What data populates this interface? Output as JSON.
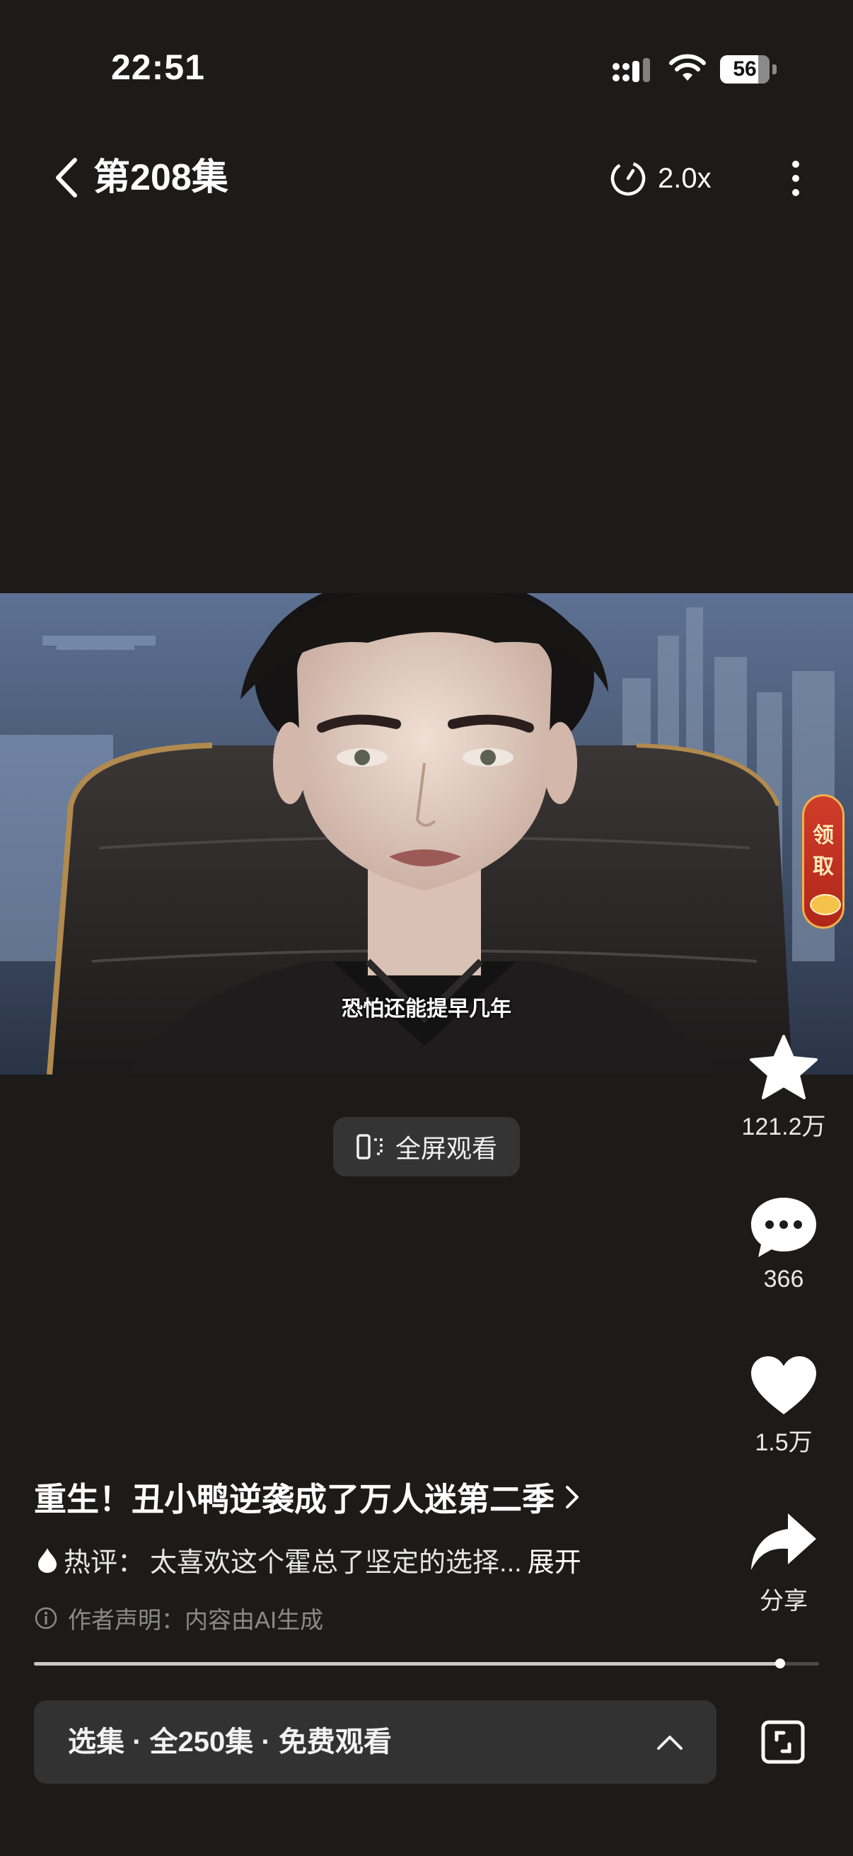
{
  "status_bar": {
    "time": "22:51",
    "battery": "56"
  },
  "header": {
    "episode": "第208集",
    "speed": "2.0x"
  },
  "video": {
    "subtitle": "恐怕还能提早几年",
    "reward_text": "领取"
  },
  "fullscreen": {
    "label": "全屏观看"
  },
  "actions": {
    "favorite_count": "121.2万",
    "comment_count": "366",
    "like_count": "1.5万",
    "share_label": "分享"
  },
  "drama": {
    "title": "重生！丑小鸭逆袭成了万人迷第二季",
    "hot_comment_prefix": "热评：",
    "hot_comment": "太喜欢这个霍总了坚定的选择...",
    "expand": "展开",
    "disclaimer": "作者声明：内容由AI生成"
  },
  "progress": {
    "fraction": 0.95
  },
  "episode_selector": {
    "label": "选集 · 全250集 · 免费观看"
  },
  "colors": {
    "background": "#1c1b1a",
    "pill": "#333232",
    "reward_red": "#cf3c2a",
    "reward_gold": "#f1b14a"
  },
  "icons": [
    "back-chevron-icon",
    "speed-icon",
    "more-icon",
    "fullscreen-icon",
    "star-icon",
    "comment-icon",
    "heart-icon",
    "share-icon",
    "fire-icon",
    "info-icon",
    "chevron-up-icon",
    "pip-icon"
  ]
}
